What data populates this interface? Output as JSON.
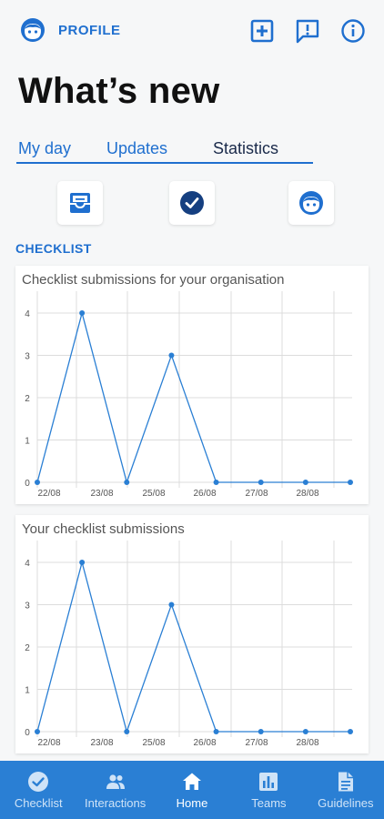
{
  "header": {
    "profile_label": "PROFILE",
    "title": "What’s new"
  },
  "tabs": [
    {
      "label": "My day"
    },
    {
      "label": "Updates"
    },
    {
      "label": "Statistics"
    }
  ],
  "section": {
    "label": "CHECKLIST"
  },
  "charts": {
    "org_title": "Checklist submissions for your organisation",
    "user_title": "Your checklist submissions"
  },
  "chart_data": [
    {
      "type": "line",
      "title": "Checklist submissions for your organisation",
      "x_tick_labels": [
        "22/08",
        "23/08",
        "25/08",
        "26/08",
        "27/08",
        "28/08"
      ],
      "y_ticks": [
        0,
        1,
        2,
        3,
        4
      ],
      "ylim": [
        0,
        4.3
      ],
      "grid": true,
      "values": [
        0,
        4,
        0,
        3,
        0,
        0,
        0,
        0
      ],
      "color": "#2a7fd4"
    },
    {
      "type": "line",
      "title": "Your checklist submissions",
      "x_tick_labels": [
        "22/08",
        "23/08",
        "25/08",
        "26/08",
        "27/08",
        "28/08"
      ],
      "y_ticks": [
        0,
        1,
        2,
        3,
        4
      ],
      "ylim": [
        0,
        4.3
      ],
      "grid": true,
      "values": [
        0,
        4,
        0,
        3,
        0,
        0,
        0,
        0
      ],
      "color": "#2a7fd4"
    }
  ],
  "bottom_nav": [
    {
      "label": "Checklist",
      "icon": "check-circle-icon"
    },
    {
      "label": "Interactions",
      "icon": "people-icon"
    },
    {
      "label": "Home",
      "icon": "home-icon"
    },
    {
      "label": "Teams",
      "icon": "bar-chart-icon"
    },
    {
      "label": "Guidelines",
      "icon": "document-icon"
    }
  ],
  "colors": {
    "accent": "#1f6fcf",
    "nav_bg": "#2a7fd4",
    "series": "#2a7fd4"
  }
}
